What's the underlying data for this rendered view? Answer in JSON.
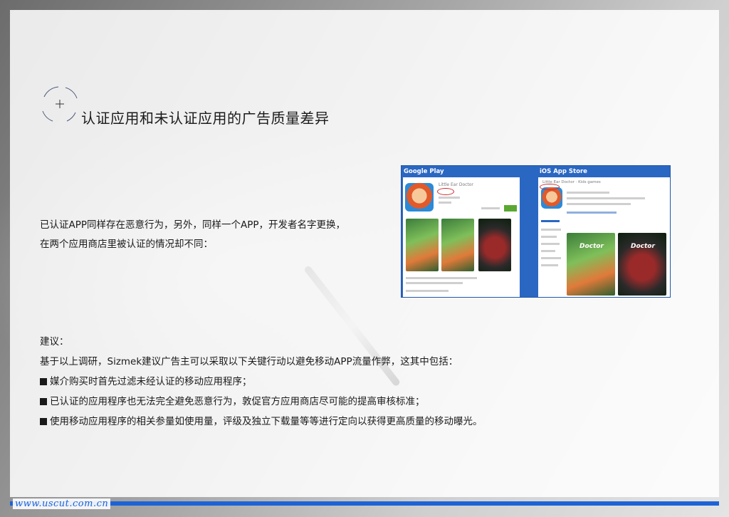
{
  "slide": {
    "title": "认证应用和未认证应用的广告质量差异",
    "intro": [
      "已认证APP同样存在恶意行为，另外，同样一个APP，开发者名字更换，",
      "在两个应用商店里被认证的情况却不同："
    ]
  },
  "screenshot": {
    "left_store": "Google Play",
    "right_store": "iOS App Store",
    "app_name": "Little Ear Doctor",
    "ios_app_name": "Little Ear Doctor · Kids games",
    "thumb_text": "Doctor"
  },
  "advice": {
    "heading": "建议：",
    "lead": "基于以上调研，Sizmek建议广告主可以采取以下关键行动以避免移动APP流量作弊，这其中包括：",
    "bullets": [
      "媒介购买时首先过滤未经认证的移动应用程序；",
      "已认证的应用程序也无法完全避免恶意行为，敦促官方应用商店尽可能的提高审核标准；",
      "使用移动应用程序的相关参量如使用量，评级及独立下载量等等进行定向以获得更高质量的移动曝光。"
    ]
  },
  "footer": {
    "url": "www.uscut.com.cn"
  },
  "colors": {
    "accent": "#1e63d6",
    "store_blue": "#2a67c2"
  }
}
